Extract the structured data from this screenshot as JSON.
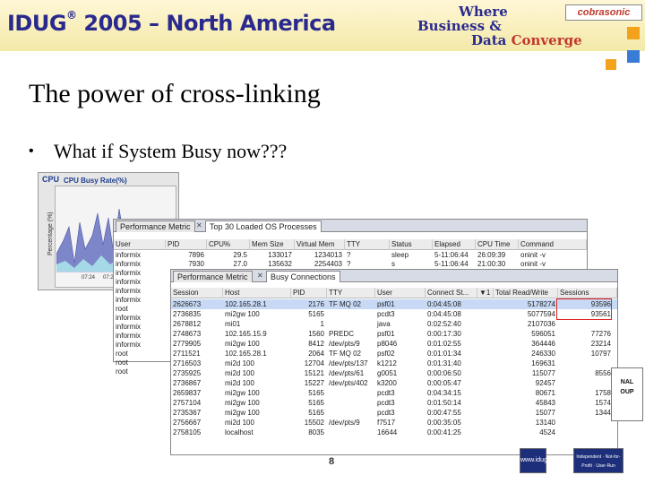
{
  "header": {
    "conference_main": "IDUG",
    "conference_sup": "®",
    "conference_rest": " 2005 – North America",
    "tagline_1": "Where",
    "tagline_2": "Business &",
    "tagline_3a": "Data ",
    "tagline_3b": "Converge",
    "sponsor": "cobrasonic",
    "colors": {
      "title_blue": "#2a2a8e",
      "accent_orange": "#f2a31b",
      "accent_blue": "#3a7bd5"
    }
  },
  "slide": {
    "title": "The power of cross-linking",
    "bullet": "What if System Busy now???",
    "page_number": "8"
  },
  "cpu_panel": {
    "label": "CPU",
    "chart_title": "CPU Busy Rate(%)",
    "y_label": "Percentage (%)",
    "x_ticks": [
      "07:24",
      "07:2"
    ]
  },
  "window_os": {
    "tabs": [
      "Performance Metric",
      "Top 30 Loaded OS Processes"
    ],
    "columns": [
      "User",
      "PID",
      "CPU%",
      "Mem Size",
      "Virtual Mem",
      "TTY",
      "Status",
      "Elapsed",
      "CPU Time",
      "Command"
    ],
    "rows": [
      [
        "informix",
        "7896",
        "29.5",
        "133017",
        "1234013",
        "?",
        "sleep",
        "5-11:06:44",
        "26:09:39",
        "oninit -v"
      ],
      [
        "informix",
        "7930",
        "27.0",
        "135632",
        "2254403",
        "?",
        "s",
        "5-11:06:44",
        "21:00:30",
        "oninit -v"
      ],
      [
        "informix",
        "",
        "",
        "",
        "",
        "",
        "",
        "",
        "",
        ""
      ],
      [
        "informix",
        "",
        "",
        "",
        "",
        "",
        "",
        "",
        "",
        ""
      ],
      [
        "informix",
        "",
        "",
        "",
        "",
        "",
        "",
        "",
        "",
        ""
      ],
      [
        "informix",
        "",
        "",
        "",
        "",
        "",
        "",
        "",
        "",
        ""
      ],
      [
        "root",
        "",
        "",
        "",
        "",
        "",
        "",
        "",
        "",
        ""
      ],
      [
        "informix",
        "",
        "",
        "",
        "",
        "",
        "",
        "",
        "",
        ""
      ],
      [
        "informix",
        "",
        "",
        "",
        "",
        "",
        "",
        "",
        "",
        ""
      ],
      [
        "informix",
        "",
        "",
        "",
        "",
        "",
        "",
        "",
        "",
        ""
      ],
      [
        "informix",
        "",
        "",
        "",
        "",
        "",
        "",
        "",
        "",
        ""
      ],
      [
        "root",
        "",
        "",
        "",
        "",
        "",
        "",
        "",
        "",
        ""
      ],
      [
        "root",
        "",
        "",
        "",
        "",
        "",
        "",
        "",
        "",
        ""
      ],
      [
        "root",
        "",
        "",
        "",
        "",
        "",
        "",
        "",
        "",
        ""
      ]
    ]
  },
  "window_conn": {
    "tabs": [
      "Performance Metric",
      "Busy Connections"
    ],
    "columns": [
      "Session",
      "Host",
      "PID",
      "TTY",
      "User",
      "Connect St...",
      "Total Read/Write",
      "Sessions"
    ],
    "sort_icon": "▼1",
    "rows": [
      [
        "2626673",
        "102.165.28.1",
        "2176",
        "TF MQ 02",
        "psf01",
        "0:04:45:08",
        "5178274",
        "93596"
      ],
      [
        "2736835",
        "mi2gw 100",
        "5165",
        "",
        "pcdt3",
        "0:04:45:08",
        "5077594",
        "93561"
      ],
      [
        "2678812",
        "mi01",
        "1",
        "",
        "java",
        "0:02:52:40",
        "2107036",
        ""
      ],
      [
        "2748673",
        "102.165.15.9",
        "1560",
        "PREDC",
        "psf01",
        "0:00:17:30",
        "596051",
        "77276"
      ],
      [
        "2779905",
        "mi2gw 100",
        "8412",
        "/dev/pts/9",
        "p8046",
        "0:01:02:55",
        "364446",
        "23214"
      ],
      [
        "2711521",
        "102.165.28.1",
        "2064",
        "TF MQ 02",
        "psf02",
        "0:01:01:34",
        "246330",
        "10797"
      ],
      [
        "2716503",
        "mi2d 100",
        "12704",
        "/dev/pts/137",
        "k1212",
        "0:01:31:40",
        "169631",
        ""
      ],
      [
        "2735925",
        "mi2d 100",
        "15121",
        "/dev/pts/61",
        "g0051",
        "0:00:06:50",
        "115077",
        "8556"
      ],
      [
        "2736867",
        "mi2d 100",
        "15227",
        "/dev/pts/402",
        "k3200",
        "0:00:05:47",
        "92457",
        ""
      ],
      [
        "2659837",
        "mi2gw 100",
        "5165",
        "",
        "pcdt3",
        "0:04:34:15",
        "80671",
        "1758"
      ],
      [
        "2757104",
        "mi2gw 100",
        "5165",
        "",
        "pcdt3",
        "0:01:50:14",
        "45843",
        "1574"
      ],
      [
        "2735367",
        "mi2gw 100",
        "5165",
        "",
        "pcdt3",
        "0:00:47:55",
        "15077",
        "1344"
      ],
      [
        "2756667",
        "mi2d 100",
        "15502",
        "/dev/pts/9",
        "f7517",
        "0:00:35:05",
        "13140",
        ""
      ],
      [
        "2758105",
        "localhost",
        "8035",
        "",
        "16644",
        "0:00:41:25",
        "4524",
        ""
      ]
    ]
  },
  "logos": {
    "bottom_left": "www.idug.org",
    "bottom_right": "Independent · Not-for-Profit · User-Run",
    "side": "NAL\nOUP"
  }
}
